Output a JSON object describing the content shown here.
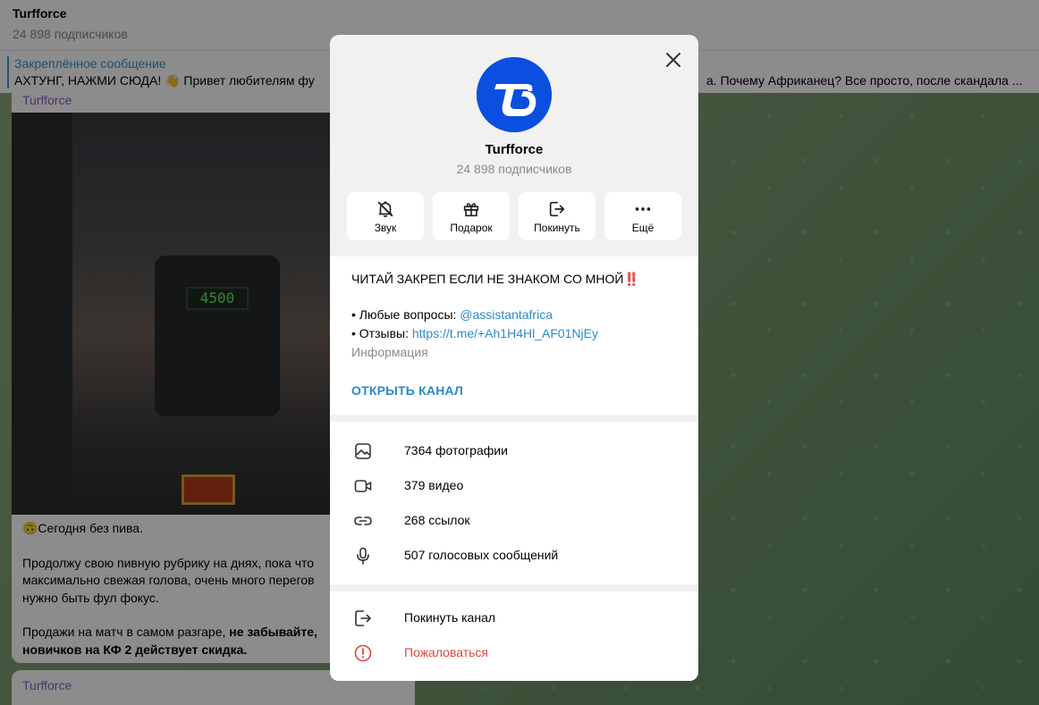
{
  "background": {
    "channel_title": "Turfforce",
    "channel_subs": "24 898 подписчиков",
    "pinned_title": "Закреплённое сообщение",
    "pinned_text_left": "АХТУНГ, НАЖМИ СЮДА! 👋 Привет любителям фу",
    "pinned_text_right": "а.  Почему Африканец? Все просто, после скандала ...",
    "post_author": "Turfforce",
    "photo_display": "4500",
    "post_line1": "🙃Сегодня без пива.",
    "post_line2a": "Продолжу свою пивную рубрику на днях, пока что",
    "post_line2b": "максимально свежая голова, очень много перегов",
    "post_line2c": "нужно быть фул фокус.",
    "post_line3a": "Продажи на матч в самом разгаре,",
    "post_line3a_bold": " не забывайте,",
    "post_line3b_bold": "новичков на КФ 2 действует скидка.",
    "post2_author": "Turfforce"
  },
  "modal": {
    "title": "Turfforce",
    "subscribers": "24 898 подписчиков",
    "actions": [
      {
        "label": "Звук",
        "icon": "bell-off-icon"
      },
      {
        "label": "Подарок",
        "icon": "gift-icon"
      },
      {
        "label": "Покинуть",
        "icon": "leave-icon"
      },
      {
        "label": "Ещё",
        "icon": "more-icon"
      }
    ],
    "description": {
      "line1": "ЧИТАЙ ЗАКРЕП ЕСЛИ НЕ ЗНАКОМ СО МНОЙ‼️",
      "q_prefix": "• Любые вопросы: ",
      "q_link": "@assistantafrica",
      "r_prefix": "• Отзывы: ",
      "r_link": "https://t.me/+Ah1H4Hl_AF01NjEy"
    },
    "info_label": "Информация",
    "open_channel": "ОТКРЫТЬ КАНАЛ",
    "media": [
      {
        "label": "7364 фотографии",
        "icon": "photo-icon"
      },
      {
        "label": "379 видео",
        "icon": "video-icon"
      },
      {
        "label": "268 ссылок",
        "icon": "link-icon"
      },
      {
        "label": "507 голосовых сообщений",
        "icon": "microphone-icon"
      }
    ],
    "leave_label": "Покинуть канал",
    "report_label": "Пожаловаться",
    "colors": {
      "accent": "#2a8ad0",
      "danger": "#e0463c",
      "avatar": "#0b4fe0"
    }
  }
}
